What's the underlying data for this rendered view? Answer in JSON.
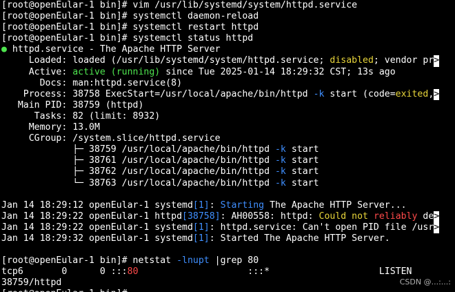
{
  "terminal": {
    "watermark": "CSDN @...:...:",
    "lines": [
      [
        {
          "t": "[root@openEular-1 bin]# vim /usr/lib/systemd/system/httpd.service"
        }
      ],
      [
        {
          "t": "[root@openEular-1 bin]# systemctl daemon-reload"
        }
      ],
      [
        {
          "t": "[root@openEular-1 bin]# systemctl restart httpd"
        }
      ],
      [
        {
          "t": "[root@openEular-1 bin]# systemctl status httpd"
        }
      ],
      [
        {
          "t": "●",
          "c": "green"
        },
        {
          "t": " httpd.service - The Apache HTTP Server"
        }
      ],
      [
        {
          "t": "     Loaded: loaded (/usr/lib/systemd/system/httpd.service; "
        },
        {
          "t": "disabled",
          "c": "yellow"
        },
        {
          "t": "; vendor pr"
        },
        {
          "t": ">",
          "c": "trunc"
        }
      ],
      [
        {
          "t": "     Active: "
        },
        {
          "t": "active (running)",
          "c": "green"
        },
        {
          "t": " since Tue 2025-01-14 18:29:32 CST; 13s ago"
        }
      ],
      [
        {
          "t": "       Docs: man:httpd.service(8)"
        }
      ],
      [
        {
          "t": "    Process: 38758 ExecStart=/usr/local/apache/bin/httpd "
        },
        {
          "t": "-k",
          "c": "blue"
        },
        {
          "t": " start (code="
        },
        {
          "t": "exited",
          "c": "yellow"
        },
        {
          "t": ","
        },
        {
          "t": ">",
          "c": "trunc"
        }
      ],
      [
        {
          "t": "   Main PID: 38759 (httpd)"
        }
      ],
      [
        {
          "t": "      Tasks: 82 (limit: 8932)"
        }
      ],
      [
        {
          "t": "     Memory: 13.0M"
        }
      ],
      [
        {
          "t": "     CGroup: /system.slice/httpd.service"
        }
      ],
      [
        {
          "t": "             ├─ 38759 /usr/local/apache/bin/httpd "
        },
        {
          "t": "-k",
          "c": "blue"
        },
        {
          "t": " start"
        }
      ],
      [
        {
          "t": "             ├─ 38761 /usr/local/apache/bin/httpd "
        },
        {
          "t": "-k",
          "c": "blue"
        },
        {
          "t": " start"
        }
      ],
      [
        {
          "t": "             ├─ 38762 /usr/local/apache/bin/httpd "
        },
        {
          "t": "-k",
          "c": "blue"
        },
        {
          "t": " start"
        }
      ],
      [
        {
          "t": "             └─ 38763 /usr/local/apache/bin/httpd "
        },
        {
          "t": "-k",
          "c": "blue"
        },
        {
          "t": " start"
        }
      ],
      [],
      [
        {
          "t": "Jan 14 18:29:12 openEular-1 systemd"
        },
        {
          "t": "[1]",
          "c": "blue"
        },
        {
          "t": ": "
        },
        {
          "t": "Starting",
          "c": "blue"
        },
        {
          "t": " The Apache HTTP Server..."
        }
      ],
      [
        {
          "t": "Jan 14 18:29:22 openEular-1 httpd"
        },
        {
          "t": "[38758]",
          "c": "blue"
        },
        {
          "t": ": AH00558: httpd: "
        },
        {
          "t": "Could not",
          "c": "yellow"
        },
        {
          "t": " "
        },
        {
          "t": "reliably",
          "c": "red"
        },
        {
          "t": " de"
        },
        {
          "t": ">",
          "c": "trunc"
        }
      ],
      [
        {
          "t": "Jan 14 18:29:22 openEular-1 systemd"
        },
        {
          "t": "[1]",
          "c": "blue"
        },
        {
          "t": ": httpd.service: Can't open PID file /usr"
        },
        {
          "t": ">",
          "c": "trunc"
        }
      ],
      [
        {
          "t": "Jan 14 18:29:32 openEular-1 systemd"
        },
        {
          "t": "[1]",
          "c": "blue"
        },
        {
          "t": ": Started The Apache HTTP Server."
        }
      ],
      [],
      [
        {
          "t": "[root@openEular-1 bin]# netstat "
        },
        {
          "t": "-lnupt",
          "c": "blue"
        },
        {
          "t": " |grep 80"
        }
      ],
      [
        {
          "t": "tcp6       0      0 :::"
        },
        {
          "t": "80",
          "c": "red"
        },
        {
          "t": "                    :::*                    LISTEN"
        }
      ],
      [
        {
          "t": "38759/httpd"
        }
      ],
      [
        {
          "t": "[root@openEular-1 bin]#"
        }
      ]
    ]
  }
}
